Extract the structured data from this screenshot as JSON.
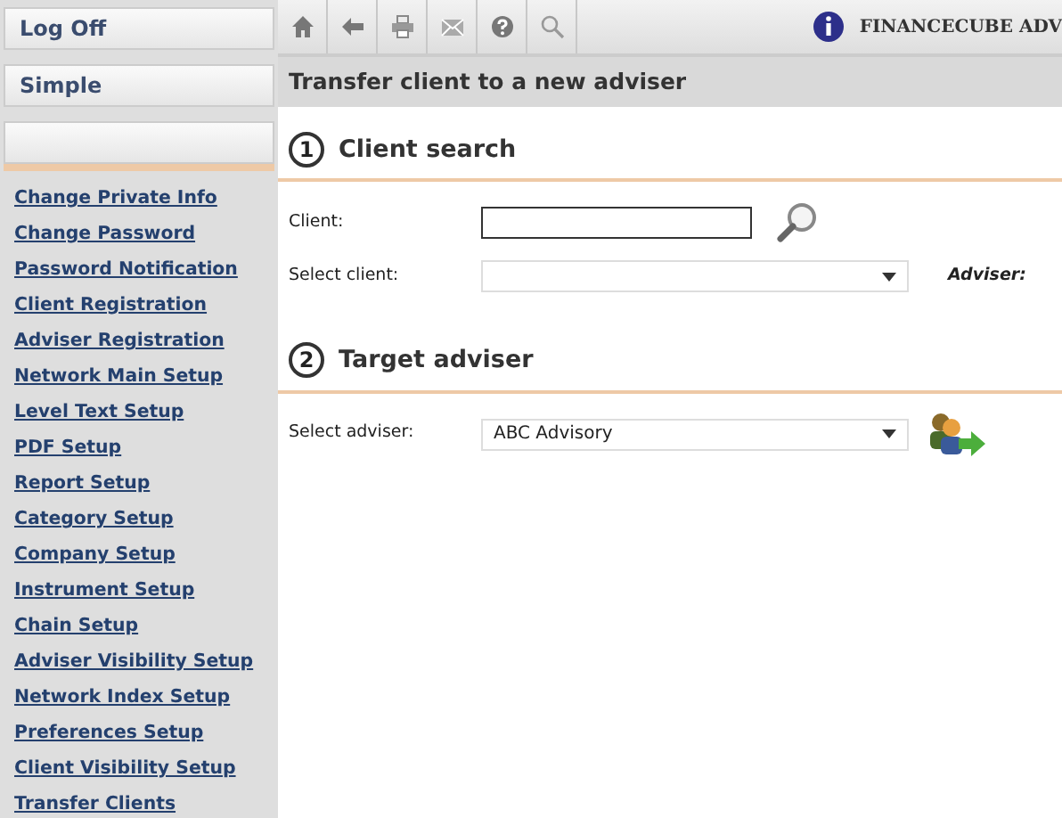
{
  "sidebar": {
    "buttons": [
      {
        "kind": "labeled",
        "label": "Log Off"
      },
      {
        "kind": "labeled",
        "label": "Simple"
      },
      {
        "kind": "blank"
      }
    ],
    "links": [
      "Change Private Info",
      "Change Password",
      "Password Notification",
      "Client Registration",
      "Adviser Registration",
      "Network Main Setup",
      "Level Text Setup",
      "PDF Setup",
      "Report Setup",
      "Category Setup",
      "Company Setup",
      "Instrument Setup",
      "Chain Setup",
      "Adviser Visibility Setup",
      "Network Index Setup",
      "Preferences Setup",
      "Client Visibility Setup",
      "Transfer Clients"
    ]
  },
  "toolbar": {
    "brand": "FINANCECUBE ADV"
  },
  "page_title": "Transfer client to a new adviser",
  "sections": [
    {
      "number": "1",
      "title": "Client search",
      "fields": [
        {
          "kind": "text",
          "label": "Client:"
        },
        {
          "kind": "select",
          "label": "Select client:",
          "aside": "Adviser:"
        }
      ]
    },
    {
      "number": "2",
      "title": "Target adviser",
      "fields": [
        {
          "kind": "select",
          "label": "Select adviser:",
          "value": "ABC Advisory"
        }
      ]
    }
  ]
}
